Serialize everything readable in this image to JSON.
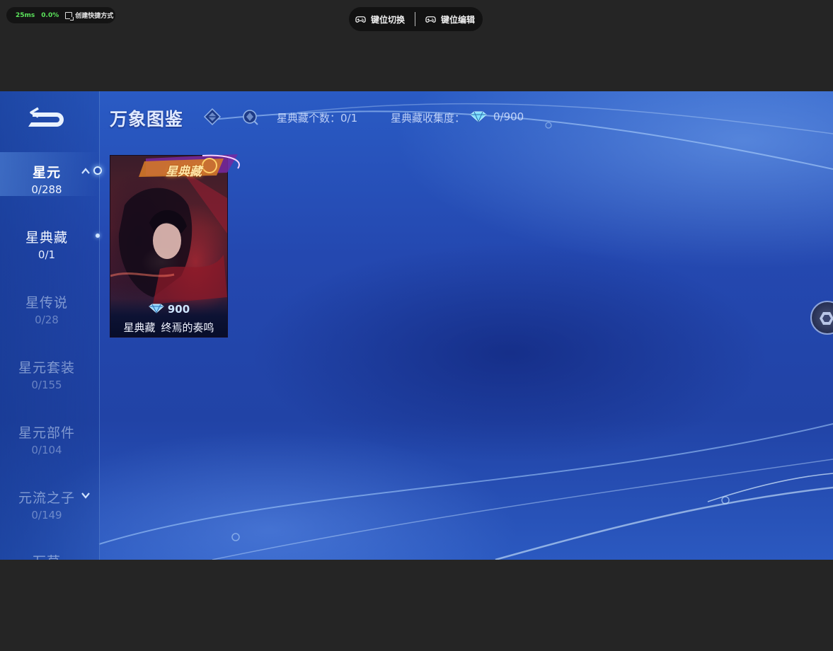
{
  "perf": {
    "latency": "25ms",
    "loss": "0.0%",
    "shortcut_label": "创建快捷方式"
  },
  "key_toolbar": {
    "switch_label": "键位切换",
    "edit_label": "键位编辑"
  },
  "header": {
    "title": "万象图鉴",
    "collection_count": "星典藏个数：0/1",
    "collection_progress_label": "星典藏收集度：",
    "collection_progress_value": "0/900"
  },
  "sidebar": {
    "items": [
      {
        "label": "星元",
        "count": "0/288"
      },
      {
        "label": "星典藏",
        "count": "0/1"
      },
      {
        "label": "星传说",
        "count": "0/28"
      },
      {
        "label": "星元套装",
        "count": "0/155"
      },
      {
        "label": "星元部件",
        "count": "0/104"
      },
      {
        "label": "元流之子",
        "count": "0/149"
      },
      {
        "label": "万草",
        "count": ""
      }
    ]
  },
  "card": {
    "badge": "星典藏",
    "price": "900",
    "category": "星典藏",
    "name": "终焉的奏鸣"
  },
  "icons": {
    "back": "back-arrow-icon",
    "filter": "diamond-filter-icon",
    "search": "search-gem-icon",
    "gem": "crystal-gem-icon",
    "gamepad": "gamepad-icon"
  },
  "colors": {
    "viewport_bg": "#2448b0",
    "emulator_bg": "#252525",
    "accent_green": "#5be35b"
  }
}
